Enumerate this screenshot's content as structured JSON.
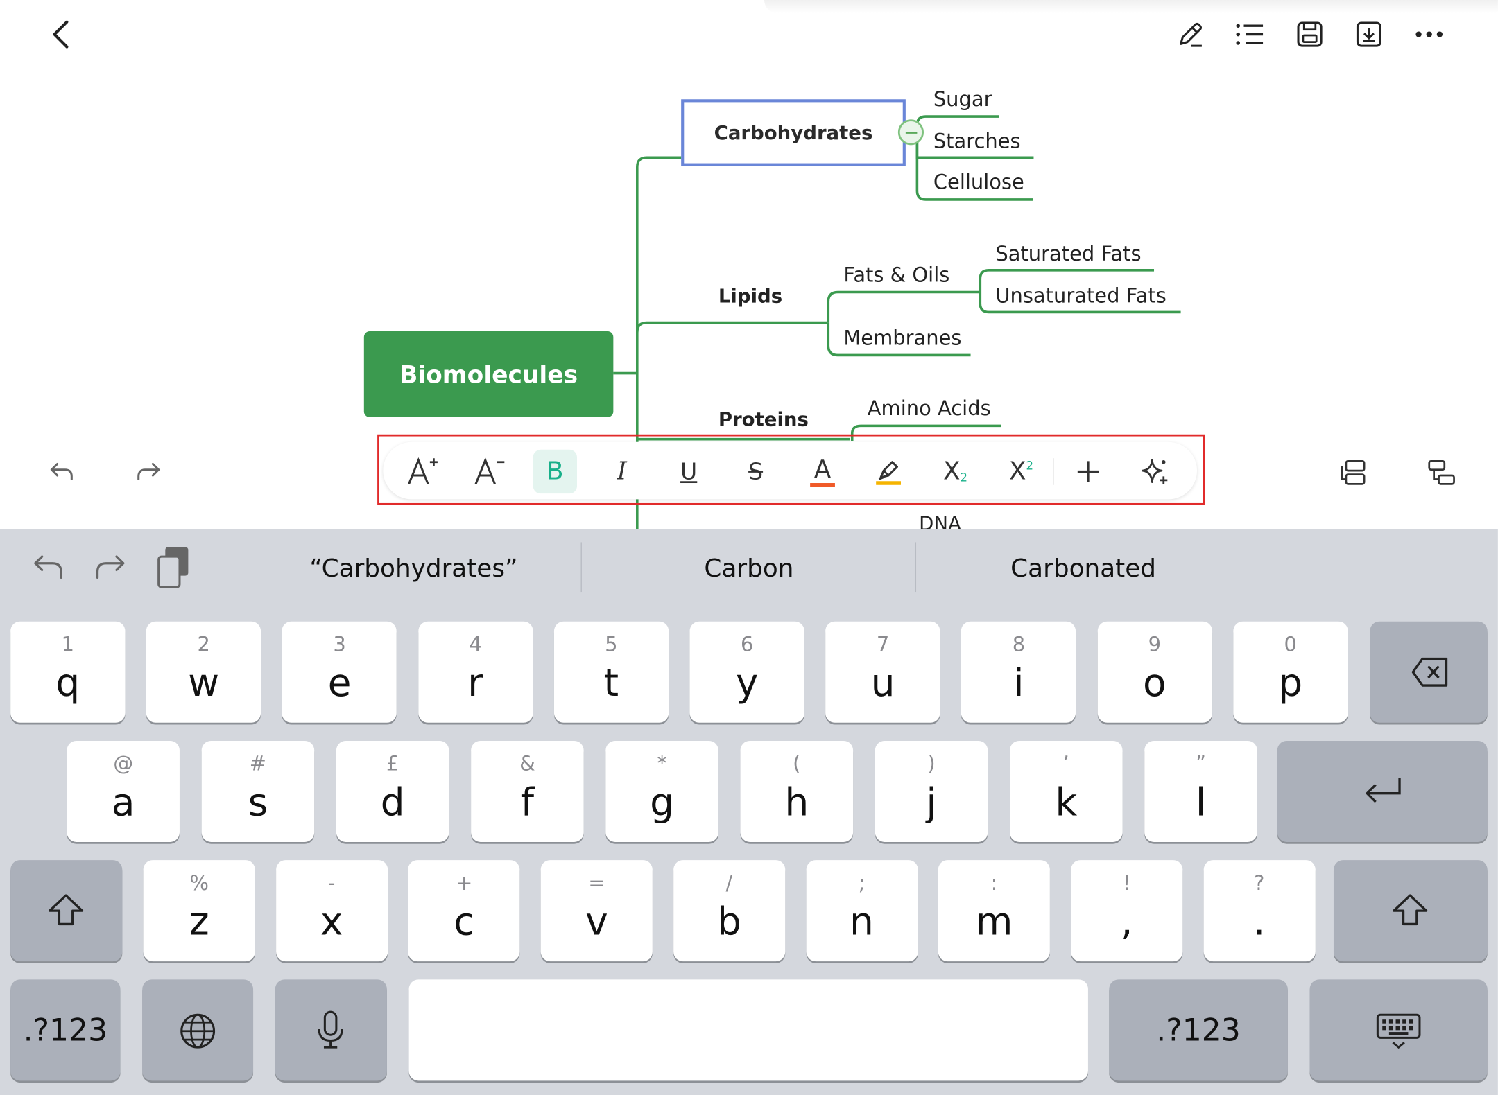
{
  "colors": {
    "branch": "#3b9a4f",
    "root_fill": "#3b9a4f",
    "selection_border": "#6a86d8",
    "toolbar_outline": "#e12b2b",
    "bold_active": "#18b08a",
    "font_color_bar": "#f05a28",
    "highlight_bar": "#f5b400",
    "keyboard_bg": "#d4d7dd"
  },
  "topbar": {
    "back_icon": "chevron-left-icon",
    "actions": [
      "pencil-icon",
      "outline-list-icon",
      "save-icon",
      "export-icon",
      "more-icon"
    ]
  },
  "mindmap": {
    "root": "Biomolecules",
    "branches": [
      {
        "label": "Carbohydrates",
        "children": [
          "Sugar",
          "Starches",
          "Cellulose"
        ]
      },
      {
        "label": "Lipids",
        "children": [
          {
            "label": "Fats & Oils",
            "children": [
              "Saturated Fats",
              "Unsaturated Fats"
            ]
          },
          "Membranes"
        ]
      },
      {
        "label": "Proteins",
        "children": [
          "Amino Acids"
        ]
      },
      {
        "label": "",
        "children": [
          "DNA"
        ]
      }
    ]
  },
  "edit_bar": {
    "undo_icon": "undo-icon",
    "redo_icon": "redo-icon",
    "right_icons": [
      "insert-sibling-icon",
      "insert-child-icon"
    ]
  },
  "format_toolbar": {
    "items": [
      "increase-font-icon",
      "decrease-font-icon",
      "bold-icon",
      "italic-icon",
      "underline-icon",
      "strikethrough-icon",
      "font-color-icon",
      "highlight-icon",
      "subscript-icon",
      "superscript-icon",
      "add-icon",
      "ai-sparkle-icon"
    ],
    "active": "bold-icon",
    "glyphs": {
      "bold": "B",
      "italic": "I",
      "underline": "U",
      "strike": "S",
      "color": "A",
      "sub": "X",
      "sup": "X",
      "subscript_num": "2",
      "superscript_num": "2"
    }
  },
  "keyboard": {
    "suggestions": [
      "“Carbohydrates”",
      "Carbon",
      "Carbonated"
    ],
    "row1": [
      {
        "h": "1",
        "k": "q"
      },
      {
        "h": "2",
        "k": "w"
      },
      {
        "h": "3",
        "k": "e"
      },
      {
        "h": "4",
        "k": "r"
      },
      {
        "h": "5",
        "k": "t"
      },
      {
        "h": "6",
        "k": "y"
      },
      {
        "h": "7",
        "k": "u"
      },
      {
        "h": "8",
        "k": "i"
      },
      {
        "h": "9",
        "k": "o"
      },
      {
        "h": "0",
        "k": "p"
      }
    ],
    "row2": [
      {
        "h": "@",
        "k": "a"
      },
      {
        "h": "#",
        "k": "s"
      },
      {
        "h": "£",
        "k": "d"
      },
      {
        "h": "&",
        "k": "f"
      },
      {
        "h": "*",
        "k": "g"
      },
      {
        "h": "(",
        "k": "h"
      },
      {
        "h": ")",
        "k": "j"
      },
      {
        "h": "’",
        "k": "k"
      },
      {
        "h": "”",
        "k": "l"
      }
    ],
    "row3": [
      {
        "h": "%",
        "k": "z"
      },
      {
        "h": "-",
        "k": "x"
      },
      {
        "h": "+",
        "k": "c"
      },
      {
        "h": "=",
        "k": "v"
      },
      {
        "h": "/",
        "k": "b"
      },
      {
        "h": ";",
        "k": "n"
      },
      {
        "h": ":",
        "k": "m"
      },
      {
        "h": "!",
        "k": ","
      },
      {
        "h": "?",
        "k": "."
      }
    ],
    "numbers_label": ".?123",
    "numbers_label_right": ".?123"
  }
}
